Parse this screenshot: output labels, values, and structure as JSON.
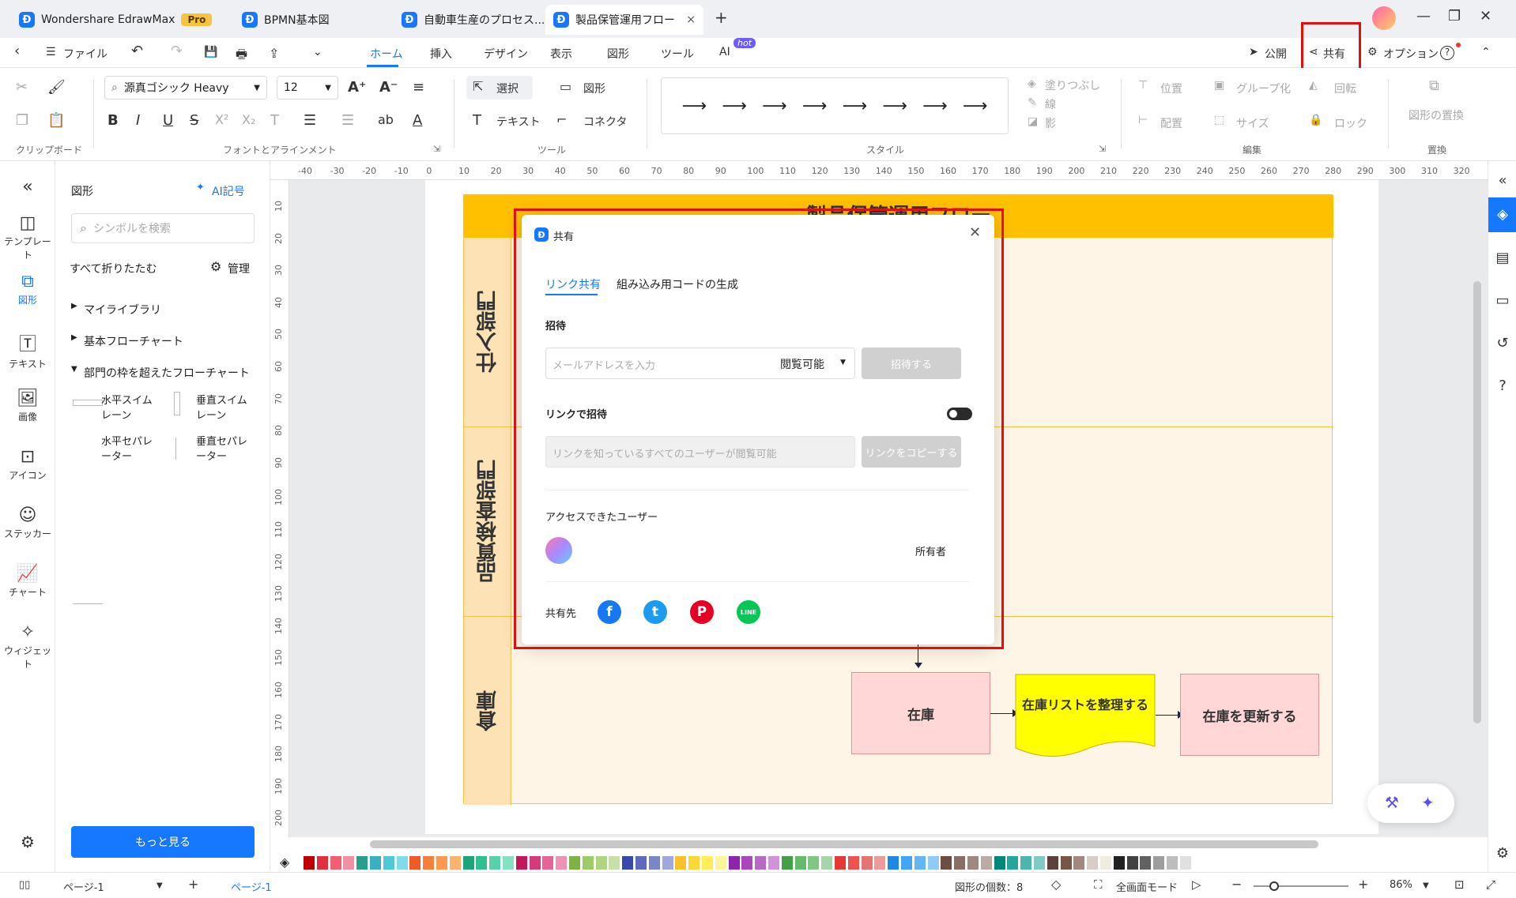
{
  "titlebar": {
    "app_tab": "Wondershare EdrawMax",
    "pro_badge": "Pro",
    "tabs": [
      "BPMN基本図",
      "自動車生産のプロセス...",
      "製品保管運用フロー"
    ],
    "new_tab": "+",
    "close_tab": "×",
    "minimize": "—",
    "restore": "❐",
    "close": "✕"
  },
  "menubar": {
    "back": "‹",
    "file_icon": "☰",
    "file": "ファイル",
    "undo": "↶",
    "redo": "↷",
    "save": "💾",
    "print": "🖶",
    "export": "⇪",
    "more": "⌄",
    "items": [
      "ホーム",
      "挿入",
      "デザイン",
      "表示",
      "図形",
      "ツール",
      "AI"
    ],
    "ai_badge": "hot",
    "publish": "公開",
    "share": "共有",
    "options": "オプション",
    "help": "?",
    "collapse": "⌃"
  },
  "ribbon": {
    "font_name": "源真ゴシック Heavy",
    "font_size": "12",
    "select": "選択",
    "shape": "図形",
    "text": "テキスト",
    "connector": "コネクタ",
    "fill": "塗りつぶし",
    "line": "線",
    "shadow": "影",
    "position": "位置",
    "group": "グループ化",
    "rotate": "回転",
    "align": "配置",
    "size": "サイズ",
    "lock": "ロック",
    "replace_shape": "図形の置換",
    "groups": [
      "クリップボード",
      "フォントとアラインメント",
      "ツール",
      "スタイル",
      "編集",
      "置換"
    ],
    "format_glyphs": [
      "B",
      "I",
      "U",
      "S",
      "X²",
      "X₂",
      "T",
      "☰",
      "☰",
      "ab",
      "A"
    ]
  },
  "left_icons": [
    {
      "label": "テンプレート",
      "icon": "template-icon"
    },
    {
      "label": "図形",
      "icon": "shapes-icon"
    },
    {
      "label": "テキスト",
      "icon": "text-icon"
    },
    {
      "label": "画像",
      "icon": "image-icon"
    },
    {
      "label": "アイコン",
      "icon": "icon-library-icon"
    },
    {
      "label": "ステッカー",
      "icon": "sticker-icon"
    },
    {
      "label": "チャート",
      "icon": "chart-icon"
    },
    {
      "label": "ウィジェット",
      "icon": "widget-icon"
    }
  ],
  "panel": {
    "title": "図形",
    "ai_symbol": "AI記号",
    "search_placeholder": "シンボルを検索",
    "collapse_all": "すべて折りたたむ",
    "manage": "管理",
    "tree": [
      "マイライブラリ",
      "基本フローチャート",
      "部門の枠を超えたフローチャート"
    ],
    "shapes": [
      "水平スイムレーン",
      "垂直スイムレーン",
      "水平セパレーター",
      "垂直セパレーター"
    ],
    "more_button": "もっと見る"
  },
  "ruler": {
    "h": [
      "-40",
      "-30",
      "-20",
      "-10",
      "0",
      "10",
      "20",
      "30",
      "40",
      "50",
      "60",
      "70",
      "80",
      "90",
      "100",
      "110",
      "120",
      "130",
      "140",
      "150",
      "160",
      "170",
      "180",
      "190",
      "200",
      "210",
      "220",
      "230",
      "240",
      "250",
      "260",
      "270",
      "280",
      "290",
      "300",
      "310",
      "320"
    ],
    "v": [
      "10",
      "20",
      "30",
      "40",
      "50",
      "60",
      "70",
      "80",
      "90",
      "100",
      "110",
      "120",
      "130",
      "140",
      "150",
      "160",
      "170",
      "180",
      "190",
      "200"
    ]
  },
  "diagram": {
    "title": "製品保管運用フロー",
    "lanes": [
      "仕入部門",
      "品質検査部門",
      "倉庫"
    ],
    "boxes": [
      "在庫",
      "在庫リストを整理する",
      "在庫を更新する"
    ]
  },
  "dialog": {
    "title": "共有",
    "tab_link": "リンク共有",
    "tab_embed": "組み込み用コードの生成",
    "invite": "招待",
    "email_placeholder": "メールアドレスを入力",
    "permission": "閲覧可能",
    "invite_button": "招待する",
    "link_invite": "リンクで招待",
    "link_permission": "リンクを知っているすべてのユーザーが閲覧可能",
    "copy_link": "リンクをコピーする",
    "access_users": "アクセスできたユーザー",
    "owner": "所有者",
    "share_to": "共有先",
    "social": [
      "f",
      "t",
      "P",
      "LINE"
    ]
  },
  "statusbar": {
    "page_selector": "ページ-1",
    "add": "+",
    "active_page": "ページ-1",
    "shape_count": "図形の個数：8",
    "fullscreen": "全画面モード",
    "zoom_out": "−",
    "zoom_in": "+",
    "zoom": "86%"
  },
  "colors": {
    "accent": "#1677ff",
    "header": "#ffc000",
    "highlight": "#e01010",
    "swatches": [
      "#c00000",
      "#e03040",
      "#f06070",
      "#f090a0",
      "#2a9d8f",
      "#3ab0c0",
      "#50c8d8",
      "#80dde8",
      "#f05a28",
      "#f77f3b",
      "#fa9a50",
      "#fbb36e",
      "#1aa67a",
      "#2fbf91",
      "#58d1a8",
      "#86e0c2",
      "#c2185b",
      "#d63a7a",
      "#e56598",
      "#ef92b6",
      "#7cb342",
      "#9ccc65",
      "#aed581",
      "#c5e1a5",
      "#3949ab",
      "#5c6bc0",
      "#7986cb",
      "#9fa8da",
      "#fbc02d",
      "#fdd835",
      "#ffee58",
      "#fff59d",
      "#8e24aa",
      "#ab47bc",
      "#ba68c8",
      "#ce93d8",
      "#43a047",
      "#66bb6a",
      "#81c784",
      "#a5d6a7",
      "#e53935",
      "#ef5350",
      "#e57373",
      "#ef9a9a",
      "#1e88e5",
      "#42a5f5",
      "#64b5f6",
      "#90caf9",
      "#6d4c41",
      "#8d6e63",
      "#a1887f",
      "#bcaaa4",
      "#00897b",
      "#26a69a",
      "#4db6ac",
      "#80cbc4",
      "#5d4037",
      "#795548",
      "#a1887f",
      "#d7ccc8",
      "#f0ece0",
      "#212121",
      "#424242",
      "#616161",
      "#9e9e9e",
      "#bdbdbd",
      "#e0e0e0"
    ]
  }
}
